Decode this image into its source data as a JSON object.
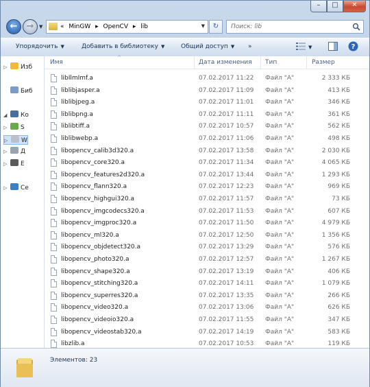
{
  "window": {
    "caption_buttons": {
      "minimize": "–",
      "maximize": "□",
      "close": "✕"
    }
  },
  "nav": {
    "back_glyph": "←",
    "forward_glyph": "→",
    "breadcrumb": [
      "«",
      "MinGW",
      "▸",
      "OpenCV",
      "▸",
      "lib"
    ],
    "refresh_glyph": "↻",
    "search_placeholder": "Поиск: lib"
  },
  "toolbar": {
    "organize": "Упорядочить",
    "add_to_library": "Добавить в библиотеку",
    "share": "Общий доступ",
    "more": "»"
  },
  "navpane": {
    "items": [
      {
        "label": "Изб",
        "color": "#f0b93a",
        "tri": "▷"
      },
      {
        "label": "Биб",
        "color": "#7a9cc6",
        "tri": ""
      },
      {
        "label": "Ко",
        "color": "#4a6e9c",
        "tri": "◢"
      },
      {
        "label": "S",
        "color": "#6aa84f",
        "tri": "▷"
      },
      {
        "label": "W",
        "color": "#b9c2cc",
        "tri": "▷"
      },
      {
        "label": "Д",
        "color": "#9aa4b0",
        "tri": "▷"
      },
      {
        "label": "E",
        "color": "#5a5a5a",
        "tri": "▷"
      },
      {
        "label": "Се",
        "color": "#3d7fc4",
        "tri": "▷"
      }
    ]
  },
  "columns": {
    "name": "Имя",
    "date": "Дата изменения",
    "type": "Тип",
    "size": "Размер"
  },
  "files": [
    {
      "name": "libIlmImf.a",
      "date": "07.02.2017 11:22",
      "type": "Файл \"A\"",
      "size": "2 333 КБ"
    },
    {
      "name": "liblibjasper.a",
      "date": "07.02.2017 11:09",
      "type": "Файл \"A\"",
      "size": "413 КБ"
    },
    {
      "name": "liblibjpeg.a",
      "date": "07.02.2017 11:01",
      "type": "Файл \"A\"",
      "size": "346 КБ"
    },
    {
      "name": "liblibpng.a",
      "date": "07.02.2017 11:11",
      "type": "Файл \"A\"",
      "size": "361 КБ"
    },
    {
      "name": "liblibtiff.a",
      "date": "07.02.2017 10:57",
      "type": "Файл \"A\"",
      "size": "562 КБ"
    },
    {
      "name": "liblibwebp.a",
      "date": "07.02.2017 11:06",
      "type": "Файл \"A\"",
      "size": "498 КБ"
    },
    {
      "name": "libopencv_calib3d320.a",
      "date": "07.02.2017 13:58",
      "type": "Файл \"A\"",
      "size": "2 030 КБ"
    },
    {
      "name": "libopencv_core320.a",
      "date": "07.02.2017 11:34",
      "type": "Файл \"A\"",
      "size": "4 065 КБ"
    },
    {
      "name": "libopencv_features2d320.a",
      "date": "07.02.2017 13:44",
      "type": "Файл \"A\"",
      "size": "1 293 КБ"
    },
    {
      "name": "libopencv_flann320.a",
      "date": "07.02.2017 12:23",
      "type": "Файл \"A\"",
      "size": "969 КБ"
    },
    {
      "name": "libopencv_highgui320.a",
      "date": "07.02.2017 11:57",
      "type": "Файл \"A\"",
      "size": "73 КБ"
    },
    {
      "name": "libopencv_imgcodecs320.a",
      "date": "07.02.2017 11:53",
      "type": "Файл \"A\"",
      "size": "607 КБ"
    },
    {
      "name": "libopencv_imgproc320.a",
      "date": "07.02.2017 11:50",
      "type": "Файл \"A\"",
      "size": "4 979 КБ"
    },
    {
      "name": "libopencv_ml320.a",
      "date": "07.02.2017 12:50",
      "type": "Файл \"A\"",
      "size": "1 356 КБ"
    },
    {
      "name": "libopencv_objdetect320.a",
      "date": "07.02.2017 13:29",
      "type": "Файл \"A\"",
      "size": "576 КБ"
    },
    {
      "name": "libopencv_photo320.a",
      "date": "07.02.2017 12:57",
      "type": "Файл \"A\"",
      "size": "1 267 КБ"
    },
    {
      "name": "libopencv_shape320.a",
      "date": "07.02.2017 13:19",
      "type": "Файл \"A\"",
      "size": "406 КБ"
    },
    {
      "name": "libopencv_stitching320.a",
      "date": "07.02.2017 14:11",
      "type": "Файл \"A\"",
      "size": "1 079 КБ"
    },
    {
      "name": "libopencv_superres320.a",
      "date": "07.02.2017 13:35",
      "type": "Файл \"A\"",
      "size": "266 КБ"
    },
    {
      "name": "libopencv_video320.a",
      "date": "07.02.2017 13:06",
      "type": "Файл \"A\"",
      "size": "626 КБ"
    },
    {
      "name": "libopencv_videoio320.a",
      "date": "07.02.2017 11:55",
      "type": "Файл \"A\"",
      "size": "347 КБ"
    },
    {
      "name": "libopencv_videostab320.a",
      "date": "07.02.2017 14:19",
      "type": "Файл \"A\"",
      "size": "583 КБ"
    },
    {
      "name": "libzlib.a",
      "date": "07.02.2017 10:53",
      "type": "Файл \"A\"",
      "size": "119 КБ"
    }
  ],
  "status": {
    "item_count": "Элементов: 23"
  }
}
